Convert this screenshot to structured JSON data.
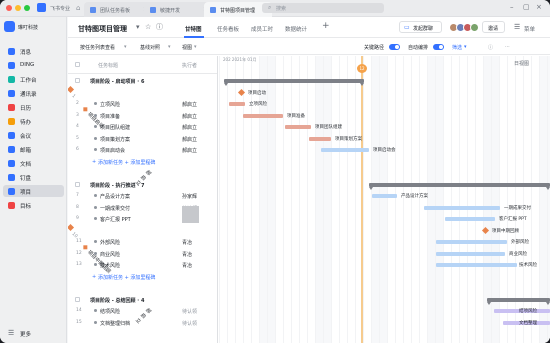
{
  "titlebar": {
    "status": "飞书专业",
    "tabs": [
      {
        "label": "团队任务看板",
        "active": false
      },
      {
        "label": "敏捷开发",
        "active": false
      },
      {
        "label": "甘特图项目管理",
        "active": true
      }
    ],
    "search_placeholder": "搜索",
    "add_tab": "+"
  },
  "sidebar": {
    "brand": "琳叮科技",
    "items": [
      {
        "label": "消息",
        "color": "#3370ff",
        "active": false
      },
      {
        "label": "DING",
        "color": "#3370ff",
        "active": false
      },
      {
        "label": "工作台",
        "color": "#14b8a6",
        "active": false
      },
      {
        "label": "通讯录",
        "color": "#3370ff",
        "active": false
      },
      {
        "label": "日历",
        "color": "#ef4444",
        "active": false
      },
      {
        "label": "待办",
        "color": "#f59e0b",
        "active": false
      },
      {
        "label": "会议",
        "color": "#3370ff",
        "active": false
      },
      {
        "label": "邮箱",
        "color": "#3370ff",
        "active": false
      },
      {
        "label": "文档",
        "color": "#3370ff",
        "active": false
      },
      {
        "label": "钉盘",
        "color": "#3370ff",
        "active": false
      },
      {
        "label": "项目",
        "color": "#3370ff",
        "active": true
      },
      {
        "label": "目标",
        "color": "#ef4444",
        "active": false
      }
    ],
    "more": "更多"
  },
  "header": {
    "title": "甘特图项目管理",
    "tabs": [
      "甘特图",
      "任务看板",
      "成员工时",
      "数据统计"
    ],
    "active_tab": "甘特图",
    "start_group_chat": "发起群聊",
    "invite": "邀请",
    "menu": "菜单"
  },
  "toolbar": {
    "group_by": "按任务列表查看",
    "align": "基线对照",
    "view": "视图",
    "critical_path": "关键路径",
    "auto_schedule": "自动编排",
    "filter": "筛选"
  },
  "table": {
    "col_title": "任务标题",
    "col_owner": "执行者",
    "rows": [
      {
        "kind": "group",
        "num": "",
        "name": "项目阶段 - 启动项目 · 6",
        "owner": ""
      },
      {
        "kind": "milestone",
        "num": "1",
        "name": "项目启动",
        "owner": "郝启立"
      },
      {
        "kind": "task",
        "num": "2",
        "name": "立项风险",
        "owner": "郝启立"
      },
      {
        "kind": "task",
        "num": "3",
        "name": "项目准备",
        "owner": "郝启立"
      },
      {
        "kind": "task",
        "num": "4",
        "name": "项目团队组建",
        "owner": "郝启立"
      },
      {
        "kind": "task",
        "num": "5",
        "name": "项目策划方案",
        "owner": "郝启立"
      },
      {
        "kind": "task",
        "num": "6",
        "name": "项目启动会",
        "owner": "郝启立"
      },
      {
        "kind": "add",
        "num": "",
        "name": "添加新任务   + 添加里程碑",
        "owner": ""
      },
      {
        "kind": "gap",
        "num": "",
        "name": "",
        "owner": ""
      },
      {
        "kind": "group",
        "num": "",
        "name": "项目阶段 - 执行推进 · 7",
        "owner": ""
      },
      {
        "kind": "task",
        "num": "7",
        "name": "产品设计方案",
        "owner": "孙家辉"
      },
      {
        "kind": "task",
        "num": "8",
        "name": "一期成果交付",
        "owner": "待认领"
      },
      {
        "kind": "task",
        "num": "9",
        "name": "客户汇报 PPT",
        "owner": "郝启立"
      },
      {
        "kind": "milestone",
        "num": "10",
        "name": "项目中期回顾",
        "owner": "郝启立"
      },
      {
        "kind": "task",
        "num": "11",
        "name": "外部风险",
        "owner": "青冶"
      },
      {
        "kind": "task",
        "num": "12",
        "name": "商业风险",
        "owner": "青冶"
      },
      {
        "kind": "task",
        "num": "13",
        "name": "技术风险",
        "owner": "青冶"
      },
      {
        "kind": "add",
        "num": "",
        "name": "添加新任务   + 添加里程碑",
        "owner": ""
      },
      {
        "kind": "gap",
        "num": "",
        "name": "",
        "owner": ""
      },
      {
        "kind": "group",
        "num": "",
        "name": "项目阶段 - 总结回顾 · 4",
        "owner": ""
      },
      {
        "kind": "task",
        "num": "14",
        "name": "结项风险",
        "owner": "待认领"
      },
      {
        "kind": "task",
        "num": "15",
        "name": "文档整理归档",
        "owner": "待认领"
      }
    ]
  },
  "gantt": {
    "month_label": "202  2021年 01月",
    "today_label": "12",
    "view_mode": "日视图",
    "bars": [
      {
        "row": 0,
        "kind": "group",
        "start": 5,
        "end": 145,
        "label": ""
      },
      {
        "row": 1,
        "kind": "milestone",
        "start": 20,
        "end": 20,
        "label": "项目启动"
      },
      {
        "row": 2,
        "kind": "red",
        "start": 10,
        "end": 26,
        "label": "立项风险"
      },
      {
        "row": 3,
        "kind": "red",
        "start": 24,
        "end": 64,
        "label": "项目准备"
      },
      {
        "row": 4,
        "kind": "red",
        "start": 66,
        "end": 92,
        "label": "项目团队组建"
      },
      {
        "row": 5,
        "kind": "red",
        "start": 90,
        "end": 112,
        "label": "项目策划方案"
      },
      {
        "row": 6,
        "kind": "blue",
        "start": 102,
        "end": 150,
        "label": "项目启动会"
      },
      {
        "row": 9,
        "kind": "group",
        "start": 150,
        "end": 331,
        "label": ""
      },
      {
        "row": 10,
        "kind": "blue",
        "start": 153,
        "end": 178,
        "label": "产品设计方案"
      },
      {
        "row": 11,
        "kind": "blue",
        "start": 205,
        "end": 281,
        "label": "一期成果交付"
      },
      {
        "row": 12,
        "kind": "blue",
        "start": 226,
        "end": 276,
        "label": "客户汇报 PPT"
      },
      {
        "row": 13,
        "kind": "milestone",
        "start": 264,
        "end": 264,
        "label": "项目中期回顾"
      },
      {
        "row": 14,
        "kind": "blue",
        "start": 217,
        "end": 288,
        "label": "外部风险"
      },
      {
        "row": 15,
        "kind": "blue",
        "start": 217,
        "end": 286,
        "label": "商业风险"
      },
      {
        "row": 16,
        "kind": "blue",
        "start": 217,
        "end": 298,
        "label": "技术风险"
      },
      {
        "row": 19,
        "kind": "group",
        "start": 268,
        "end": 331,
        "label": ""
      },
      {
        "row": 20,
        "kind": "purple",
        "start": 275,
        "end": 331,
        "label": "结项风险"
      },
      {
        "row": 21,
        "kind": "purple",
        "start": 284,
        "end": 331,
        "label": "文档整理"
      }
    ]
  }
}
